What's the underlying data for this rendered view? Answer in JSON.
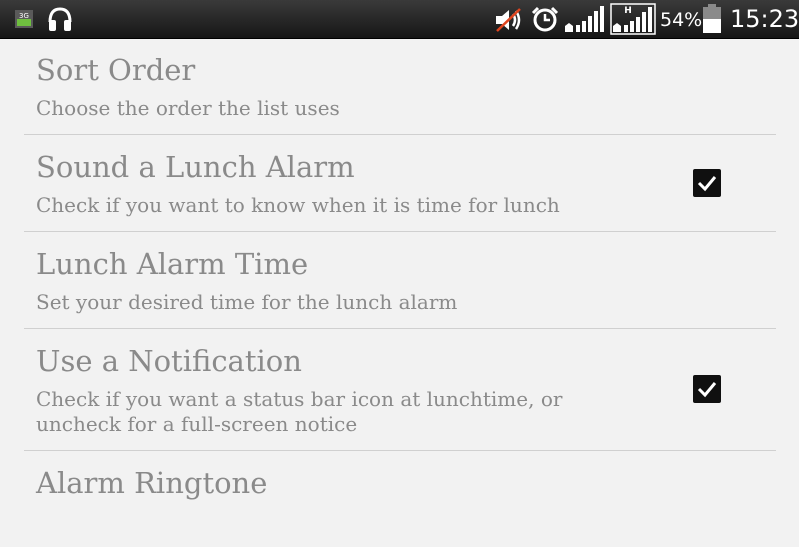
{
  "status_bar": {
    "network_type_label": "3G",
    "hspa_label": "H",
    "battery_percent": "54%",
    "battery_level": 0.54,
    "clock": "15:23",
    "icons": [
      "3g-data-icon",
      "headphones-icon",
      "muted-speaker-icon",
      "alarm-clock-icon",
      "signal-strength-icon",
      "hspa-signal-icon",
      "battery-icon"
    ]
  },
  "preferences": [
    {
      "title": "Sort Order",
      "summary": "Choose the order the list uses",
      "has_checkbox": false
    },
    {
      "title": "Sound a Lunch Alarm",
      "summary": "Check if you want to know when it is time for lunch",
      "has_checkbox": true,
      "checked": true
    },
    {
      "title": "Lunch Alarm Time",
      "summary": "Set your desired time for the lunch alarm",
      "has_checkbox": false
    },
    {
      "title": "Use a Notification",
      "summary": "Check if you want a status bar icon at lunchtime, or uncheck for a full-screen notice",
      "has_checkbox": true,
      "checked": true
    },
    {
      "title": "Alarm Ringtone",
      "summary": "",
      "has_checkbox": false
    }
  ]
}
